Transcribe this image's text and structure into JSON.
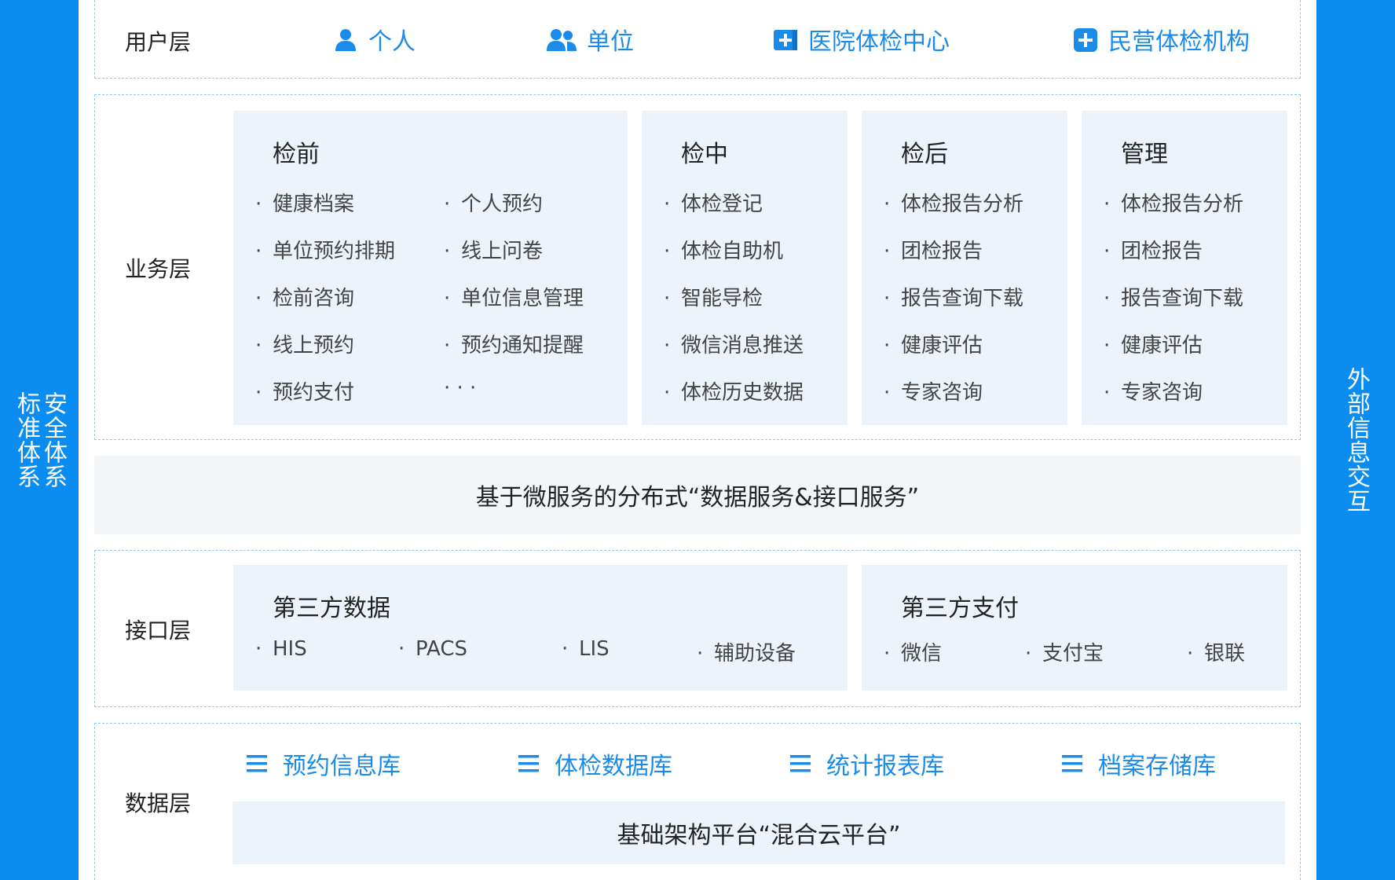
{
  "left_bar": {
    "col1": "安全体系",
    "col2": "标准体系"
  },
  "right_bar": {
    "text": "外部信息交互"
  },
  "user_layer": {
    "label": "用户层",
    "items": [
      {
        "icon": "person-icon",
        "label": "个人"
      },
      {
        "icon": "group-icon",
        "label": "单位"
      },
      {
        "icon": "hospital-plus-icon",
        "label": "医院体检中心"
      },
      {
        "icon": "medical-plus-icon",
        "label": "民营体检机构"
      }
    ]
  },
  "business_layer": {
    "label": "业务层",
    "pre": {
      "title": "检前",
      "col1": [
        "健康档案",
        "单位预约排期",
        "检前咨询",
        "线上预约",
        "预约支付"
      ],
      "col2": [
        "个人预约",
        "线上问卷",
        "单位信息管理",
        "预约通知提醒",
        "· · ·"
      ]
    },
    "during": {
      "title": "检中",
      "items": [
        "体检登记",
        "体检自助机",
        "智能导检",
        "微信消息推送",
        "体检历史数据"
      ]
    },
    "post": {
      "title": "检后",
      "items": [
        "体检报告分析",
        "团检报告",
        "报告查询下载",
        "健康评估",
        "专家咨询"
      ]
    },
    "manage": {
      "title": "管理",
      "items": [
        "体检报告分析",
        "团检报告",
        "报告查询下载",
        "健康评估",
        "专家咨询"
      ]
    }
  },
  "service_banner": "基于微服务的分布式“数据服务&接口服务”",
  "interface_layer": {
    "label": "接口层",
    "third_data": {
      "title": "第三方数据",
      "items": [
        "HIS",
        "PACS",
        "LIS",
        "辅助设备"
      ]
    },
    "third_pay": {
      "title": "第三方支付",
      "items": [
        "微信",
        "支付宝",
        "银联"
      ]
    }
  },
  "data_layer": {
    "label": "数据层",
    "dbs": [
      "预约信息库",
      "体检数据库",
      "统计报表库",
      "档案存储库"
    ],
    "platform": "基础架构平台“混合云平台”"
  },
  "colors": {
    "accent": "#0a8cf0",
    "icon_blue": "#1b8bea",
    "card_bg": "#ecf3fb"
  }
}
